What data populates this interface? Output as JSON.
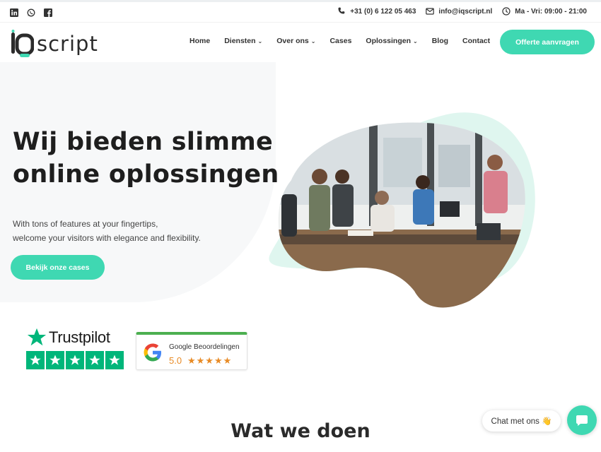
{
  "topbar": {
    "social": [
      "linkedin-icon",
      "whatsapp-icon",
      "facebook-icon"
    ],
    "phone": "+31 (0) 6 122 05 463",
    "email": "info@iqscript.nl",
    "hours": "Ma - Vri: 09:00 - 21:00"
  },
  "header": {
    "logo_text": "script",
    "nav": [
      {
        "label": "Home",
        "dropdown": false
      },
      {
        "label": "Diensten",
        "dropdown": true
      },
      {
        "label": "Over ons",
        "dropdown": true
      },
      {
        "label": "Cases",
        "dropdown": false
      },
      {
        "label": "Oplossingen",
        "dropdown": true
      },
      {
        "label": "Blog",
        "dropdown": false
      },
      {
        "label": "Contact",
        "dropdown": false
      }
    ],
    "cta_label": "Offerte aanvragen"
  },
  "hero": {
    "title": "Wij bieden slimme online oplossingen",
    "subtitle_line1": "With tons of features at your fingertips,",
    "subtitle_line2": "welcome your visitors with elegance and flexibility.",
    "button_label": "Bekijk onze cases"
  },
  "badges": {
    "trustpilot_name": "Trustpilot",
    "trustpilot_stars": 5,
    "google_title": "Google Beoordelingen",
    "google_score": "5.0",
    "google_stars": "★★★★★"
  },
  "section": {
    "title": "Wat we doen"
  },
  "chat": {
    "label": "Chat met ons 👋"
  },
  "colors": {
    "accent": "#3fd8b2",
    "trustpilot_green": "#00b67a",
    "google_star": "#e88b26"
  }
}
